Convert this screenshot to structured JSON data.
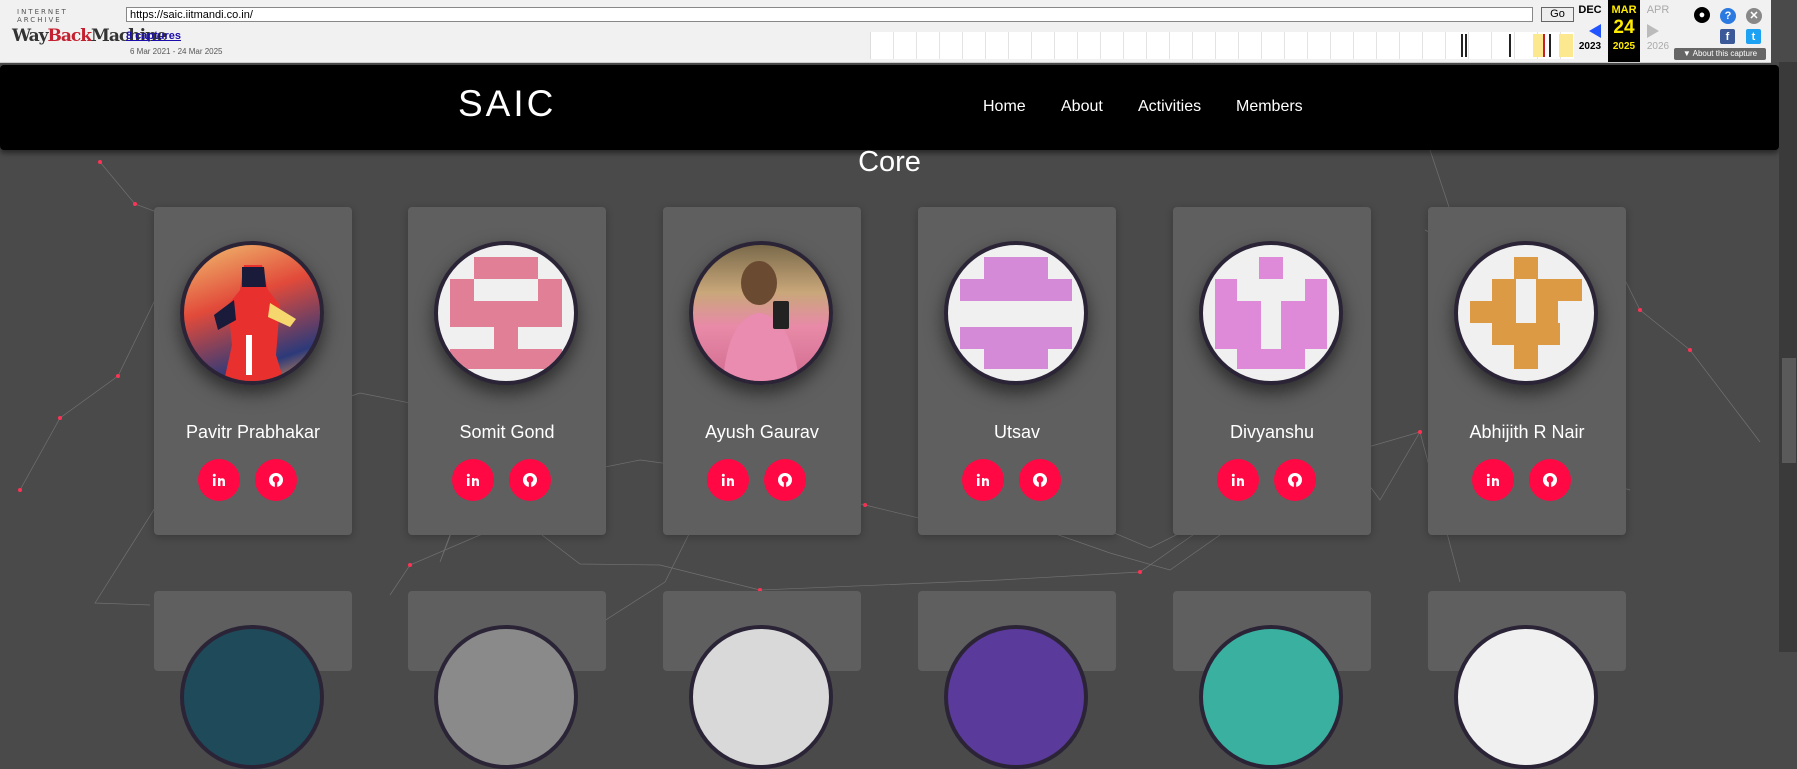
{
  "wayback": {
    "logo_top": "INTERNET ARCHIVE",
    "logo_main_1": "Way",
    "logo_main_2": "Back",
    "logo_main_3": "Machine",
    "url": "https://saic.iitmandi.co.in/",
    "go_label": "Go",
    "captures_label": "8 captures",
    "date_range": "6 Mar 2021 - 24 Mar 2025",
    "prev_month": "DEC",
    "prev_year": "2023",
    "cur_month": "MAR",
    "cur_day": "24",
    "cur_year": "2025",
    "next_month": "APR",
    "next_year": "2026",
    "about_label": "About this capture",
    "icons": [
      "user-icon",
      "help-icon",
      "close-icon",
      "facebook-icon",
      "twitter-icon"
    ]
  },
  "navbar": {
    "brand": "SAIC",
    "links": [
      "Home",
      "About",
      "Activities",
      "Members"
    ]
  },
  "section": {
    "title": "Core"
  },
  "members": [
    {
      "name": "Pavitr Prabhakar",
      "avatar": "photo-illustration"
    },
    {
      "name": "Somit Gond",
      "avatar": "identicon",
      "color": "#e07f95"
    },
    {
      "name": "Ayush Gaurav",
      "avatar": "photo"
    },
    {
      "name": "Utsav",
      "avatar": "identicon",
      "color": "#d58ad8"
    },
    {
      "name": "Divyanshu",
      "avatar": "identicon",
      "color": "#de8ad8"
    },
    {
      "name": "Abhijith R Nair",
      "avatar": "identicon",
      "color": "#dc9a45"
    }
  ],
  "social_icons": [
    "linkedin-icon",
    "github-icon"
  ],
  "colors": {
    "accent": "#ff0844",
    "background": "#4a4a4a",
    "card": "#5f5f5f",
    "navbar": "#000000"
  }
}
